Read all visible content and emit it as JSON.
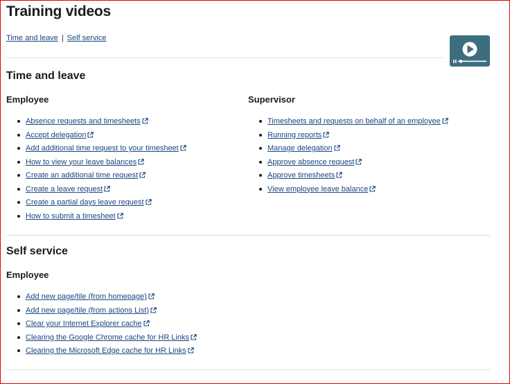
{
  "page": {
    "title": "Training videos",
    "breadcrumb": [
      "Time and leave",
      "Self service"
    ],
    "breadcrumb_separator": "|"
  },
  "accent": {
    "link": "#1a4480",
    "video_button": "#3d6e80",
    "frame_border": "#e30000"
  },
  "icons": {
    "video": "play-video-icon",
    "external": "external-link-icon"
  },
  "time_and_leave": {
    "heading": "Time and leave",
    "employee": {
      "heading": "Employee",
      "links": [
        "Absence requests and timesheets",
        "Accept delegation",
        "Add additional time request to your timesheet",
        "How to view your leave balances",
        "Create an additional time request",
        "Create a leave request",
        "Create a partial days leave request",
        "How to submit a timesheet"
      ]
    },
    "supervisor": {
      "heading": "Supervisor",
      "links": [
        "Timesheets and requests on behalf of an employee",
        "Running reports",
        "Manage delegation",
        "Approve absence request",
        "Approve timesheets",
        "View employee leave balance"
      ]
    }
  },
  "self_service": {
    "heading": "Self service",
    "employee": {
      "heading": "Employee",
      "links": [
        "Add new page/tile (from homepage)",
        "Add new page/tile (from actions List)",
        "Clear your Internet Explorer cache",
        "Clearing the Google Chrome cache for HR Links",
        "Clearing the Microsoft Edge cache for HR Links"
      ]
    }
  }
}
